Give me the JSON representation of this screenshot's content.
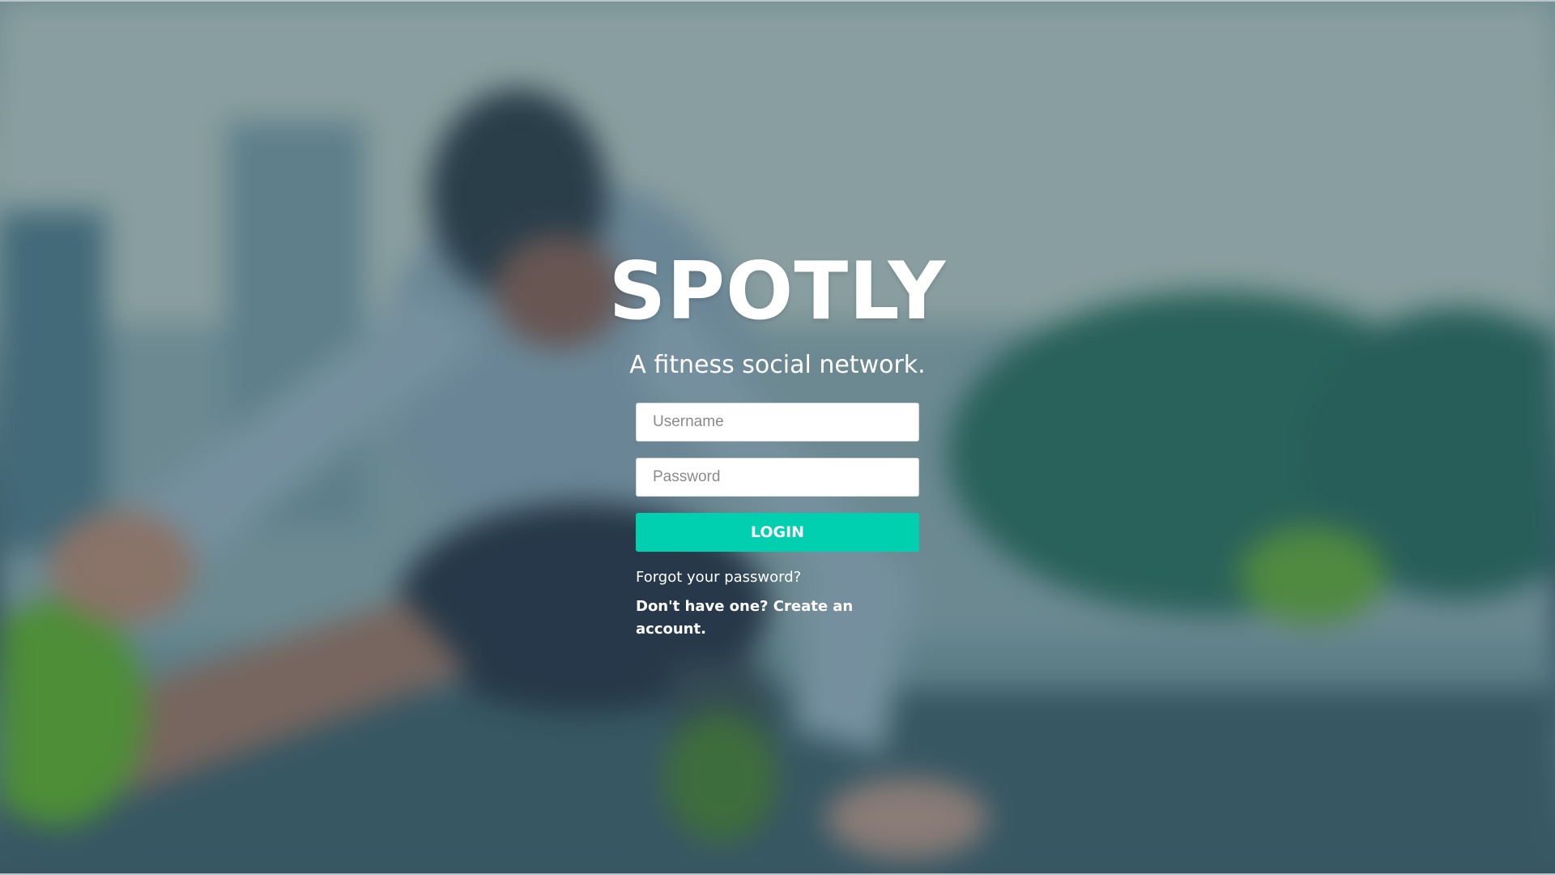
{
  "app": {
    "logo": "SPOTLY",
    "tagline": "A fitness social network."
  },
  "login_form": {
    "username_placeholder": "Username",
    "password_placeholder": "Password",
    "login_label": "LOGIN",
    "forgot_password_label": "Forgot your password?",
    "create_account_label": "Don't have one? Create an account."
  },
  "colors": {
    "accent": "#00cfb0",
    "text": "#ffffff"
  }
}
